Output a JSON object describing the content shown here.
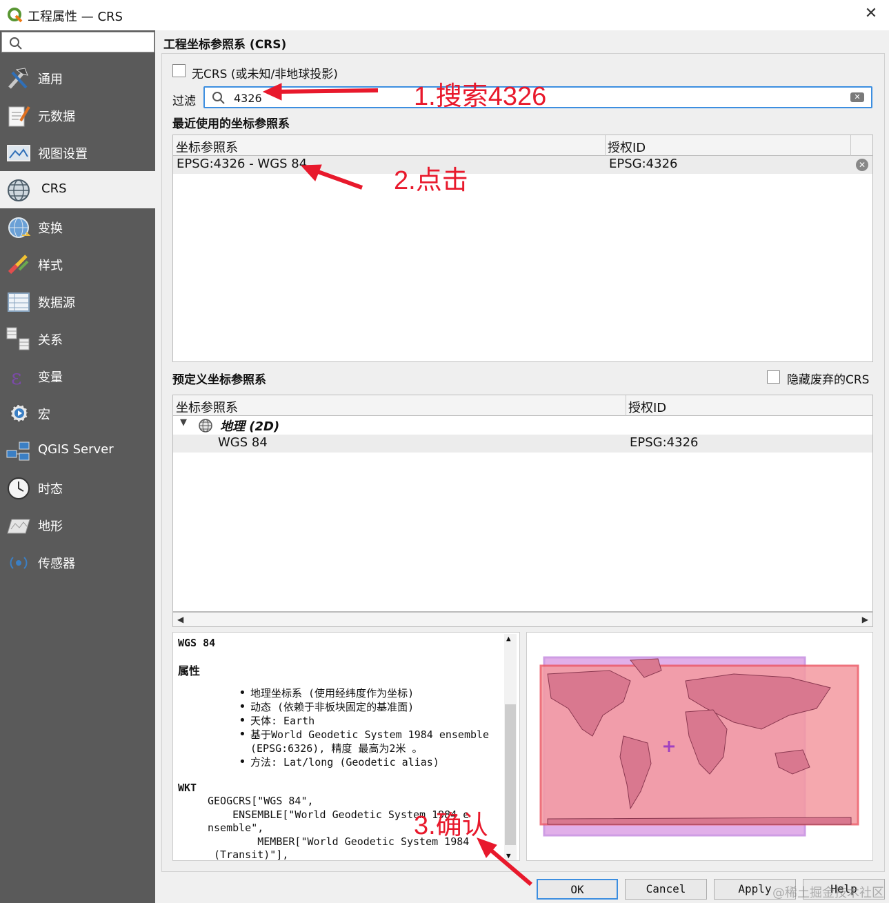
{
  "window": {
    "title": "工程属性 — CRS",
    "close": "✕"
  },
  "sidebar": {
    "items": [
      {
        "label": "通用",
        "icon": "wrench-hammer-icon"
      },
      {
        "label": "元数据",
        "icon": "metadata-pen-icon"
      },
      {
        "label": "视图设置",
        "icon": "view-settings-icon"
      },
      {
        "label": "CRS",
        "icon": "globe-icon"
      },
      {
        "label": "变换",
        "icon": "transform-globe-icon"
      },
      {
        "label": "样式",
        "icon": "paint-brush-icon"
      },
      {
        "label": "数据源",
        "icon": "data-sources-icon"
      },
      {
        "label": "关系",
        "icon": "relations-icon"
      },
      {
        "label": "变量",
        "icon": "variable-epsilon-icon"
      },
      {
        "label": "宏",
        "icon": "macro-gear-icon"
      },
      {
        "label": "QGIS Server",
        "icon": "server-icon"
      },
      {
        "label": "时态",
        "icon": "clock-icon"
      },
      {
        "label": "地形",
        "icon": "terrain-map-icon"
      },
      {
        "label": "传感器",
        "icon": "sensor-icon"
      }
    ],
    "active_index": 3
  },
  "main": {
    "section_title": "工程坐标参照系 (CRS)",
    "no_crs_label": "无CRS (或未知/非地球投影)",
    "filter_label": "过滤",
    "filter_value": "4326",
    "recent_title": "最近使用的坐标参照系",
    "recent_table": {
      "headers": [
        "坐标参照系",
        "授权ID"
      ],
      "rows": [
        {
          "crs": "EPSG:4326 - WGS 84",
          "auth_id": "EPSG:4326"
        }
      ]
    },
    "predefined_title": "预定义坐标参照系",
    "hide_deprecated_label": "隐藏废弃的CRS",
    "predefined_table": {
      "headers": [
        "坐标参照系",
        "授权ID"
      ],
      "group": "地理 (2D)",
      "rows": [
        {
          "crs": "WGS 84",
          "auth_id": "EPSG:4326"
        }
      ]
    },
    "info": {
      "name": "WGS 84",
      "properties_title": "属性",
      "properties": [
        "地理坐标系 (使用经纬度作为坐标)",
        "动态 (依赖于非板块固定的基准面)",
        "天体: Earth",
        "基于World Geodetic System 1984 ensemble",
        "(EPSG:6326), 精度 最高为2米 。",
        "方法: Lat/long (Geodetic alias)"
      ],
      "wkt_title": "WKT",
      "wkt_lines": [
        "GEOGCRS[\"WGS 84\",",
        "    ENSEMBLE[\"World Geodetic System 1984 e",
        "nsemble\",",
        "        MEMBER[\"World Geodetic System 1984",
        " (Transit)\"],"
      ]
    }
  },
  "buttons": {
    "ok": "OK",
    "cancel": "Cancel",
    "apply": "Apply",
    "help": "Help"
  },
  "annotations": {
    "step1": "1.搜索4326",
    "step2": "2.点击",
    "step3": "3.确认"
  },
  "watermark": "@稀土掘金技术社区",
  "colors": {
    "accent": "#3c8ee0",
    "annotation": "#e8192c",
    "sidebar": "#5a5a5a"
  }
}
